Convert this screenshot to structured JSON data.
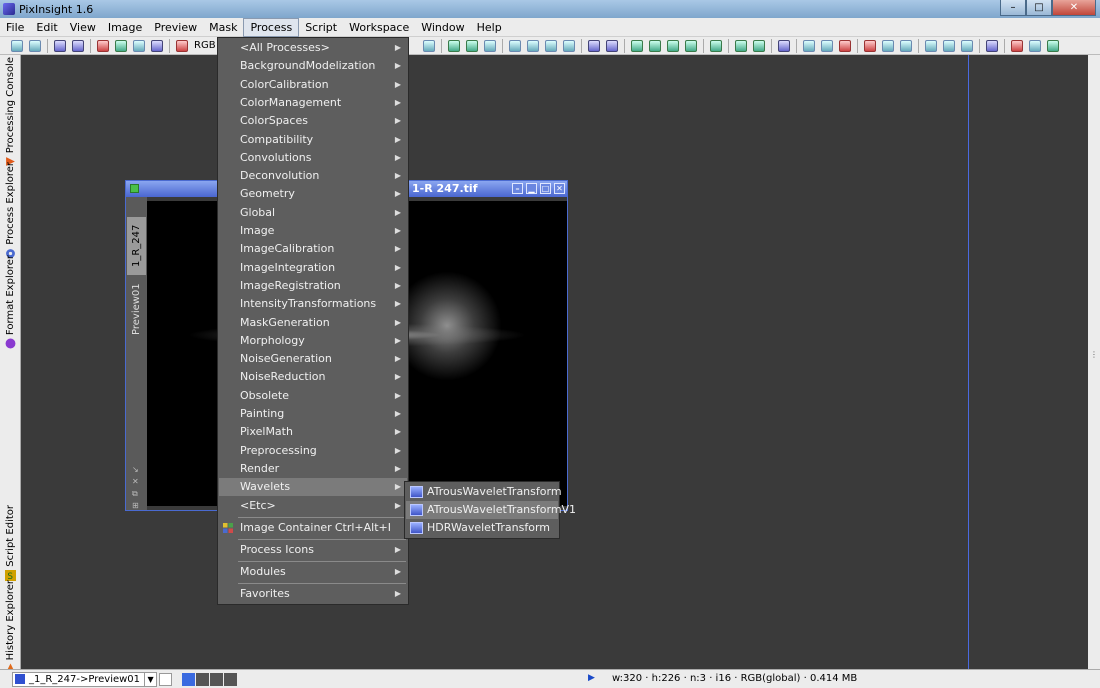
{
  "app": {
    "title": "PixInsight 1.6"
  },
  "window_controls": {
    "minimize": "–",
    "maximize": "□",
    "close": "✕"
  },
  "menubar": {
    "items": [
      "File",
      "Edit",
      "View",
      "Image",
      "Preview",
      "Mask",
      "Process",
      "Script",
      "Workspace",
      "Window",
      "Help"
    ],
    "active_index": 6
  },
  "toolbar": {
    "rgb_label": "RGB"
  },
  "left_panel": {
    "tabs": [
      {
        "label": "Processing Console",
        "icon": "play-triangle-icon",
        "color": "#e05a1a"
      },
      {
        "label": "Process Explorer",
        "icon": "gear-icon",
        "color": "#4a6ad0"
      },
      {
        "label": "Format Explorer",
        "icon": "sphere-icon",
        "color": "#8a3ad0"
      },
      {
        "label": "Script Editor",
        "icon": "script-icon",
        "color": "#d0a000"
      },
      {
        "label": "History Explorer",
        "icon": "warning-triangle-icon",
        "color": "#e06a1a"
      }
    ]
  },
  "image_window": {
    "title": "1-R 247.tif",
    "tabs": [
      "1_R_247",
      "Preview01"
    ],
    "active_tab_index": 0
  },
  "process_menu": {
    "categories": [
      "<All Processes>",
      "BackgroundModelization",
      "ColorCalibration",
      "ColorManagement",
      "ColorSpaces",
      "Compatibility",
      "Convolutions",
      "Deconvolution",
      "Geometry",
      "Global",
      "Image",
      "ImageCalibration",
      "ImageIntegration",
      "ImageRegistration",
      "IntensityTransformations",
      "MaskGeneration",
      "Morphology",
      "NoiseGeneration",
      "NoiseReduction",
      "Obsolete",
      "Painting",
      "PixelMath",
      "Preprocessing",
      "Render",
      "Wavelets",
      "<Etc>"
    ],
    "highlighted": "Wavelets",
    "image_container": {
      "label": "Image Container",
      "shortcut": "Ctrl+Alt+I"
    },
    "process_icons": "Process Icons",
    "modules": "Modules",
    "favorites": "Favorites"
  },
  "wavelets_submenu": {
    "items": [
      "ATrousWaveletTransform",
      "ATrousWaveletTransformV1",
      "HDRWaveletTransform"
    ],
    "highlighted_index": 1
  },
  "statusbar": {
    "view_selector": "_1_R_247->Preview01",
    "image_info": "w:320 · h:226 · n:3 · i16 · RGB(global) · 0.414 MB"
  },
  "colors": {
    "menu_bg": "#5e5e5e",
    "menu_highlight": "#7b7b7b",
    "workspace_bg": "#3a3a3a",
    "window_accent": "#4a66d0"
  }
}
